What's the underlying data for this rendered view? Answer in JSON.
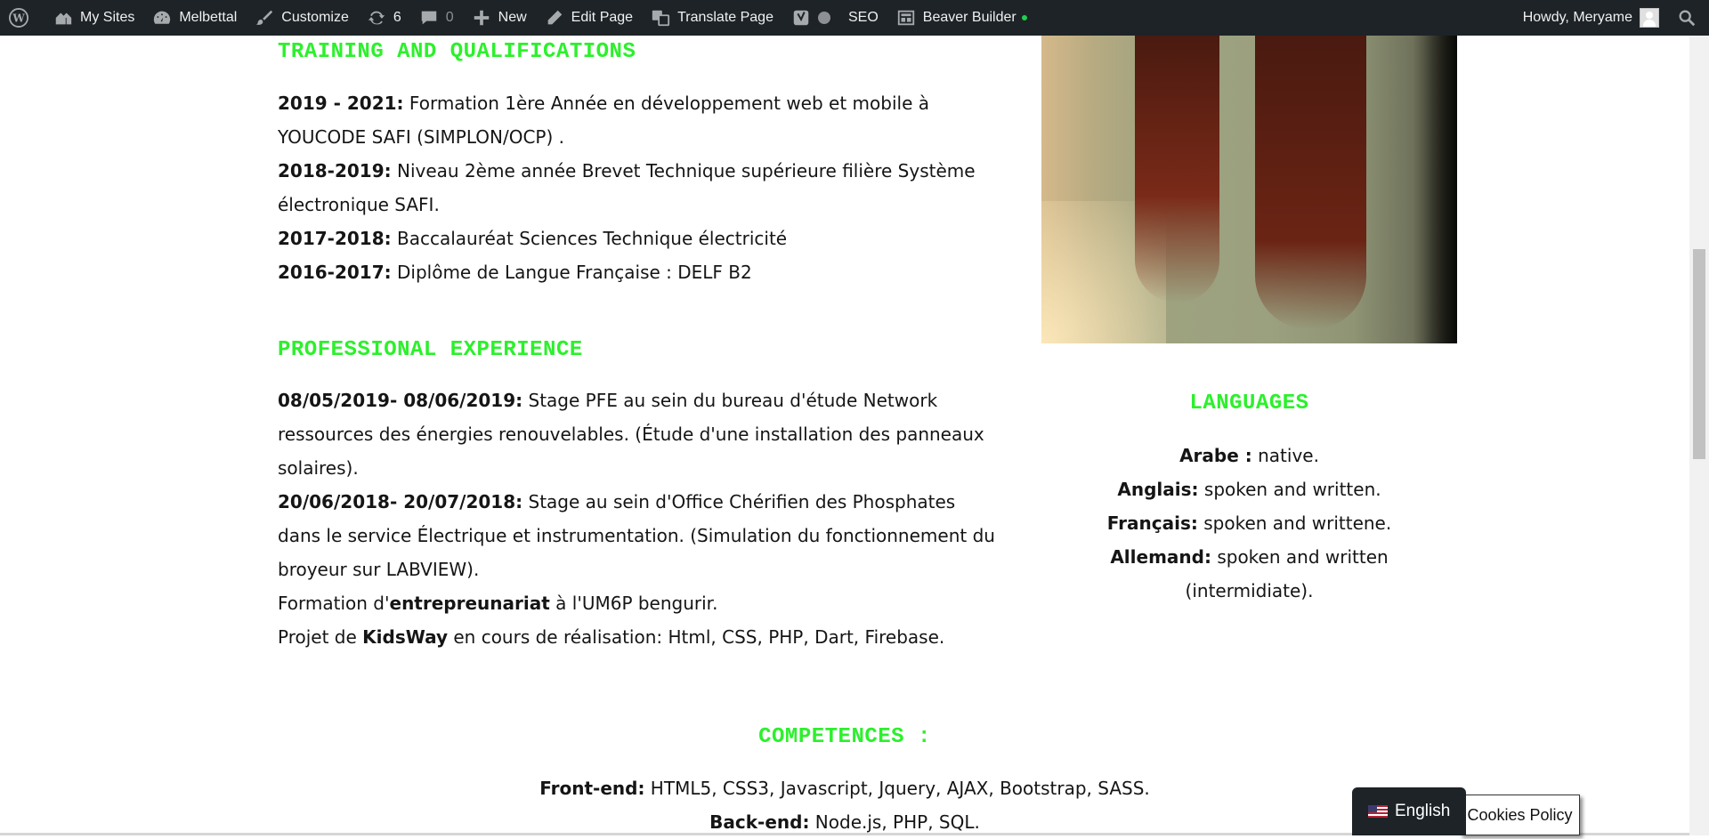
{
  "adminbar": {
    "my_sites": "My Sites",
    "site_name": "Melbettal",
    "customize": "Customize",
    "updates_count": "6",
    "comments_count": "0",
    "new": "New",
    "edit_page": "Edit Page",
    "translate_page": "Translate Page",
    "seo": "SEO",
    "beaver_builder": "Beaver Builder",
    "howdy": "Howdy, Meryame"
  },
  "training": {
    "heading": "TRAINING AND QUALIFICATIONS",
    "items": [
      {
        "date": "2019 - 2021:",
        "text": " Formation 1ère Année en développement web et mobile à YOUCODE SAFI (SIMPLON/OCP) ."
      },
      {
        "date": "2018-2019:",
        "text": " Niveau 2ème année Brevet Technique supérieure filière Système électronique SAFI."
      },
      {
        "date": "2017-2018:",
        "text": " Baccalauréat Sciences Technique électricité"
      },
      {
        "date": "2016-2017:",
        "text": " Diplôme de Langue Française : DELF B2"
      }
    ]
  },
  "experience": {
    "heading": "PROFESSIONAL EXPERIENCE",
    "items": [
      {
        "date": "08/05/2019- 08/06/2019:",
        "text": " Stage PFE au sein du bureau d'étude Network ressources des énergies renouvelables. (Étude d'une installation des panneaux solaires)."
      },
      {
        "date": "20/06/2018- 20/07/2018:",
        "text": " Stage au sein d'Office Chérifien des Phosphates dans le service Électrique et instrumentation. (Simulation du fonctionnement du broyeur sur LABVIEW)."
      }
    ],
    "formation": {
      "pre": "Formation d'",
      "bold": "entrepreunariat",
      "post": " à l'UM6P bengurir."
    },
    "projet": {
      "pre": "Projet de ",
      "bold": "KidsWay",
      "post": " en cours de réalisation: Html, CSS, PHP, Dart, Firebase."
    }
  },
  "languages": {
    "heading": "LANGUAGES",
    "items": [
      {
        "name": "Arabe :",
        "level": " native."
      },
      {
        "name": "Anglais:",
        "level": " spoken and written."
      },
      {
        "name": "Français:",
        "level": " spoken and writtene."
      },
      {
        "name": "Allemand:",
        "level": " spoken and written (intermidiate)."
      }
    ]
  },
  "competences": {
    "heading": "COMPETENCES :",
    "items": [
      {
        "name": "Front-end:",
        "value": " HTML5, CSS3, Javascript, Jquery, AJAX, Bootstrap, SASS."
      },
      {
        "name": "Back-end:",
        "value": " Node.js, PHP, SQL."
      }
    ]
  },
  "language_switcher": {
    "label": "English"
  },
  "cookies": {
    "label": "Cookies Policy"
  },
  "colors": {
    "heading": "#2cf02c",
    "adminbar": "#1d2327",
    "text": "#151515"
  }
}
